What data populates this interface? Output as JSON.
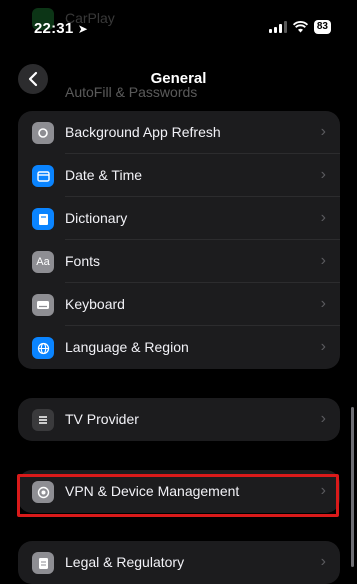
{
  "status_bar": {
    "time": "22:31",
    "battery": "83"
  },
  "ghost": {
    "label": "CarPlay"
  },
  "nav": {
    "title": "General",
    "behind_label": "AutoFill & Passwords"
  },
  "group1": {
    "items": [
      {
        "label": "Background App Refresh",
        "icon": "refresh-icon",
        "color": "#8e8e93"
      },
      {
        "label": "Date & Time",
        "icon": "calendar-icon",
        "color": "#0a84ff"
      },
      {
        "label": "Dictionary",
        "icon": "book-icon",
        "color": "#0a84ff"
      },
      {
        "label": "Fonts",
        "icon": "fonts-icon",
        "color": "#8e8e93"
      },
      {
        "label": "Keyboard",
        "icon": "keyboard-icon",
        "color": "#8e8e93"
      },
      {
        "label": "Language & Region",
        "icon": "globe-icon",
        "color": "#0a84ff"
      }
    ]
  },
  "group2": {
    "label": "TV Provider",
    "icon": "tv-provider-icon",
    "color": "#3a3a3c"
  },
  "group3": {
    "label": "VPN & Device Management",
    "icon": "gear-icon",
    "color": "#8e8e93"
  },
  "group4": {
    "label": "Legal & Regulatory",
    "icon": "document-icon",
    "color": "#8e8e93"
  },
  "chevron": "›"
}
